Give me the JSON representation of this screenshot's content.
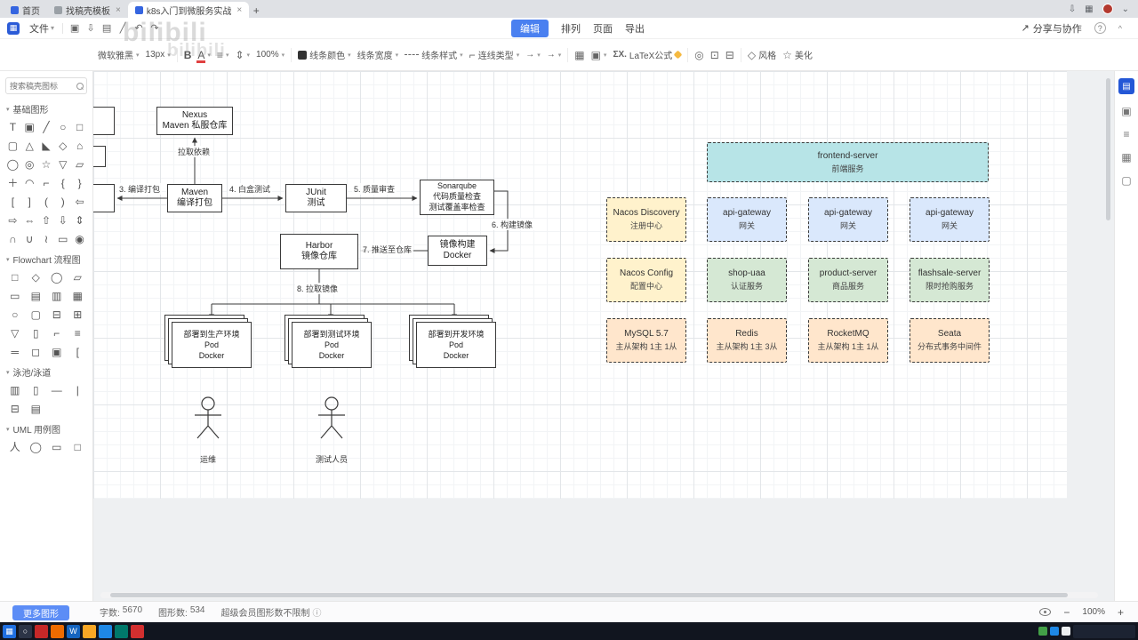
{
  "watermark": "bilibili",
  "browser": {
    "tabs": [
      {
        "label": "首页"
      },
      {
        "label": "找稿壳模板"
      },
      {
        "label": "k8s入门到微服务实战"
      }
    ],
    "new_tab": "+"
  },
  "menubar": {
    "file": "文件",
    "modes": [
      "编辑",
      "排列",
      "页面",
      "导出"
    ],
    "share": "分享与协作",
    "help": "?"
  },
  "toolbar": {
    "font_family": "微软雅黑",
    "font_size": "13px",
    "bold": "B",
    "font_color": "A",
    "opacity": "100%",
    "line_color": "线条颜色",
    "line_width": "线条宽度",
    "line_style": "线条样式",
    "connector_type": "连线类型",
    "arrow_start": "→",
    "arrow_end": "→",
    "latex_sigma": "ΣX.",
    "latex": "LaTeX公式",
    "style": "风格",
    "beautify": "美化"
  },
  "sidebar": {
    "search_placeholder": "搜索稿壳图标",
    "sections": {
      "basic": "基础图形",
      "flowchart": "Flowchart 流程图",
      "swimlane": "泳池/泳道",
      "uml": "UML 用例图"
    },
    "basic_shapes": [
      "T",
      "▣",
      "╱",
      "○",
      "□",
      "▢",
      "△",
      "◣",
      "◇",
      "⌂",
      "◯",
      "◎",
      "☆",
      "▽",
      "▱",
      "＋",
      "◠",
      "⌐",
      "{",
      "}",
      "[",
      "]",
      "(",
      ")",
      "⇦",
      "⇨",
      "⇔",
      "⇧",
      "⇩",
      "⇕",
      "∩",
      "∪",
      "≀",
      "▭",
      "◉"
    ],
    "flow_shapes": [
      "□",
      "◇",
      "◯",
      "▱",
      "▭",
      "▤",
      "▥",
      "▦",
      "○",
      "▢",
      "⊟",
      "⊞",
      "▽",
      "▯",
      "⌐",
      "≡",
      "═",
      "◻",
      "▣",
      "["
    ],
    "swim_shapes": [
      "▥",
      "▯",
      "—",
      "|",
      "⊟",
      "▤"
    ],
    "uml_shapes": [
      "人",
      "◯",
      "▭",
      "□"
    ],
    "more": "更多图形"
  },
  "canvas": {
    "nodes": {
      "nexus": "Nexus\nMaven 私服仓库",
      "maven": "Maven\n编译打包",
      "junit": "JUnit\n测试",
      "sonarqube": "Sonarqube\n代码质量检查\n测试覆盖率检查",
      "docker_build": "镜像构建\nDocker",
      "harbor": "Harbor\n镜像仓库",
      "deploy_prod": "部署到生产环境\nPod\nDocker",
      "deploy_test": "部署到测试环境\nPod\nDocker",
      "deploy_dev": "部署到开发环境\nPod\nDocker"
    },
    "edge_labels": {
      "pull_dep": "拉取依赖",
      "step3": "3. 编译打包",
      "step4": "4. 白盒测试",
      "step5": "5. 质量审查",
      "step6": "6. 构建镜像",
      "step7": "7. 推送至仓库",
      "step8": "8. 拉取镜像"
    },
    "actors": [
      {
        "label": "运维"
      },
      {
        "label": "测试人员"
      }
    ],
    "services": {
      "frontend": {
        "title": "frontend-server",
        "subtitle": "前端服务"
      },
      "rows": [
        [
          {
            "title": "Nacos Discovery",
            "subtitle": "注册中心",
            "color": "yellow"
          },
          {
            "title": "api-gateway",
            "subtitle": "网关",
            "color": "blue"
          },
          {
            "title": "api-gateway",
            "subtitle": "网关",
            "color": "blue"
          },
          {
            "title": "api-gateway",
            "subtitle": "网关",
            "color": "blue"
          }
        ],
        [
          {
            "title": "Nacos Config",
            "subtitle": "配置中心",
            "color": "yellow"
          },
          {
            "title": "shop-uaa",
            "subtitle": "认证服务",
            "color": "green"
          },
          {
            "title": "product-server",
            "subtitle": "商品服务",
            "color": "green"
          },
          {
            "title": "flashsale-server",
            "subtitle": "限时抢购服务",
            "color": "green"
          }
        ],
        [
          {
            "title": "MySQL 5.7",
            "subtitle": "主从架构 1主 1从",
            "color": "orange"
          },
          {
            "title": "Redis",
            "subtitle": "主从架构 1主 3从",
            "color": "orange"
          },
          {
            "title": "RocketMQ",
            "subtitle": "主从架构 1主 1从",
            "color": "orange"
          },
          {
            "title": "Seata",
            "subtitle": "分布式事务中间件",
            "color": "orange"
          }
        ]
      ]
    },
    "colors": {
      "cyan_fill": "#b7e4e7",
      "yellow_fill": "#fff2cc",
      "blue_fill": "#dae8fc",
      "green_fill": "#d5e8d4",
      "orange_fill": "#ffe6cc",
      "accent": "#4a80f0"
    }
  },
  "rightbar": {
    "icons": [
      "▤",
      "▣",
      "≡",
      "▦",
      "▢"
    ]
  },
  "statusbar": {
    "more_shapes": "更多图形",
    "word_count_label": "字数:",
    "word_count": "5670",
    "shape_count_label": "图形数:",
    "shape_count": "534",
    "vip_note": "超级会员图形数不限制",
    "zoom": "100%",
    "zoom_out": "−",
    "zoom_in": "+"
  }
}
